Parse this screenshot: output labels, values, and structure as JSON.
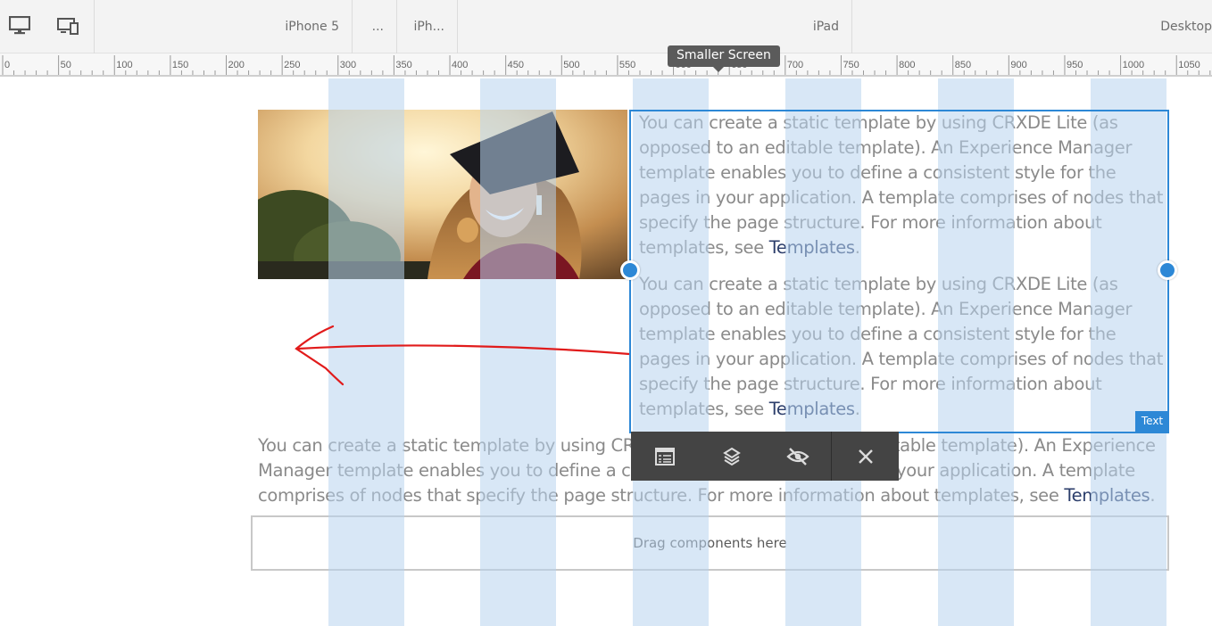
{
  "emulator": {
    "modes": [
      {
        "icon": "monitor-icon",
        "label": "Desktop mode"
      },
      {
        "icon": "responsive-device-icon",
        "label": "Emulator mode"
      }
    ],
    "devices": {
      "iphone5": "iPhone 5",
      "more": "...",
      "iph": "iPh...",
      "ipad": "iPad",
      "desktop": "Desktop"
    }
  },
  "ruler": {
    "labels": [
      "0",
      "50",
      "100",
      "150",
      "200",
      "250",
      "300",
      "350",
      "400",
      "450",
      "500",
      "550",
      "600",
      "650",
      "700",
      "750",
      "800",
      "850",
      "900",
      "950",
      "1000",
      "1050"
    ]
  },
  "tooltip": {
    "text": "Smaller Screen"
  },
  "content": {
    "text_paragraph_1": "You can create a static template by using CRXDE Lite (as opposed to an editable template). An Experience Manager template enables you to define a consistent style for the pages in your application. A template comprises of nodes that specify the page structure. For more information about templates, see ",
    "text_paragraph_2": "You can create a static template by using CRXDE Lite (as opposed to an editable template). An Experience Manager template enables you to define a consistent style for the pages in your application. A template comprises of nodes that specify the page structure. For more information about templates, see ",
    "bottom_paragraph": "You can create a static template by using CRXDE Lite (as opposed to an editable template). An Experience Manager template enables you to define a consistent style for the pages in your application. A template comprises of nodes that specify the page structure. For more information about templates, see ",
    "link_text": "Templates",
    "period": "."
  },
  "selection": {
    "component_label": "Text"
  },
  "toolbar": {
    "buttons": [
      {
        "icon": "properties-icon",
        "label": "Configure"
      },
      {
        "icon": "layers-icon",
        "label": "Parent"
      },
      {
        "icon": "hide-icon",
        "label": "Hide Component"
      },
      {
        "icon": "close-icon",
        "label": "Close"
      }
    ]
  },
  "dropzone": {
    "text": "Drag components here"
  },
  "colors": {
    "selection": "#2d88d6",
    "grid": "#b8d4ee",
    "toolbar": "#444444",
    "annotation": "#e11b1b",
    "link": "#2c3e6b"
  }
}
